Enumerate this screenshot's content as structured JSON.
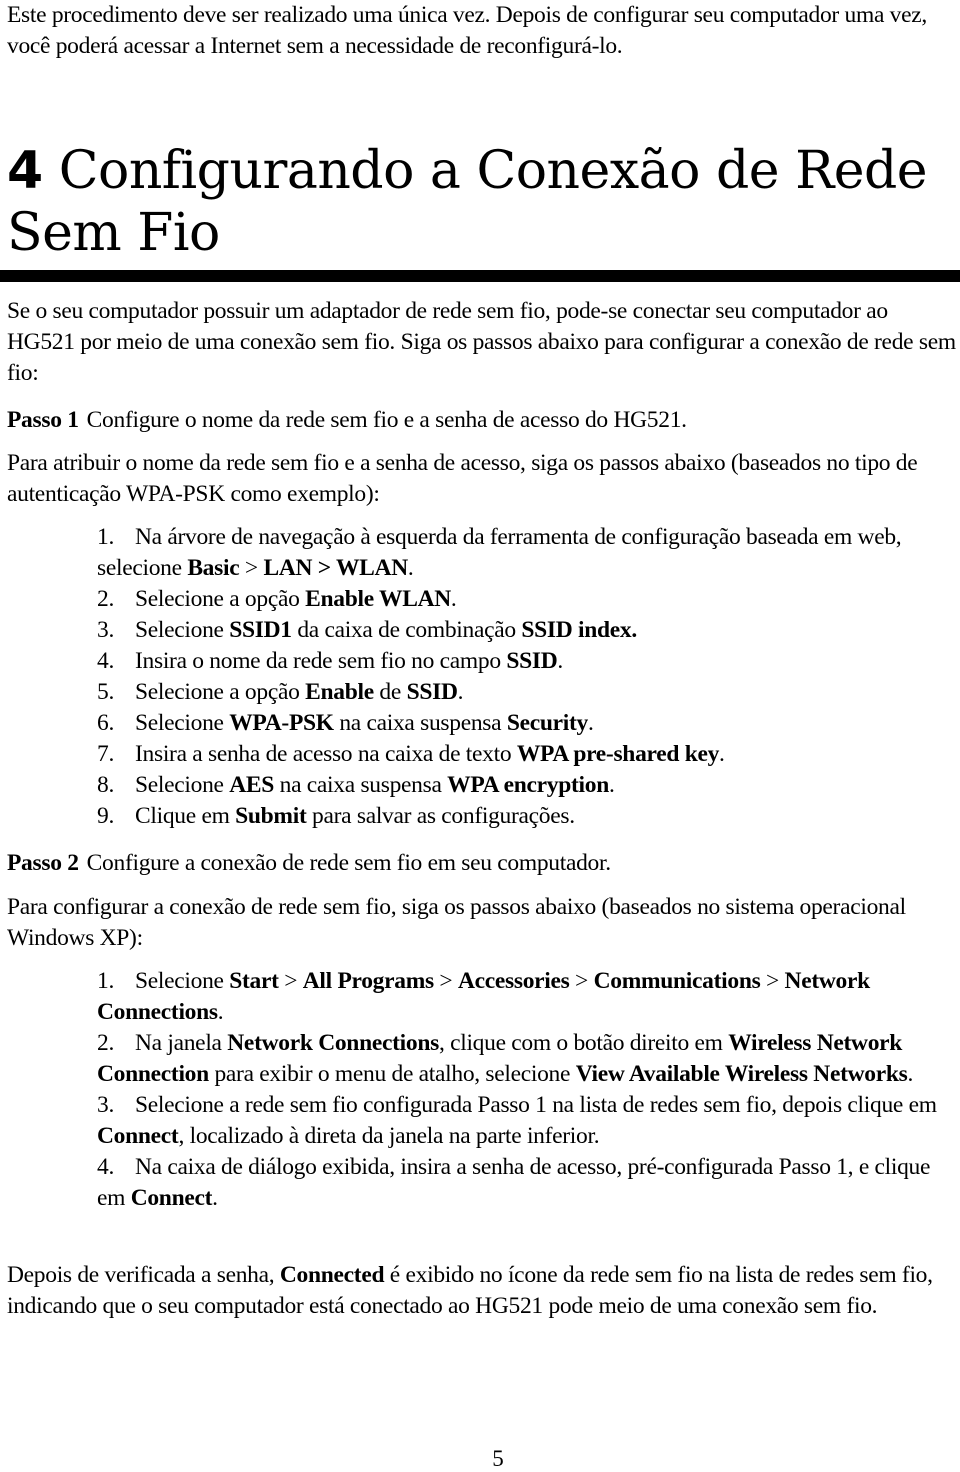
{
  "intro": {
    "text": "Este procedimento deve ser realizado uma única vez. Depois de configurar seu computador uma vez, você poderá acessar a Internet sem a necessidade de reconfigurá-lo."
  },
  "section": {
    "number": "4",
    "title": "Configurando a Conexão de Rede Sem Fio"
  },
  "section_intro": "Se o seu computador possuir um adaptador de rede sem fio, pode-se conectar seu computador ao HG521 por meio de uma conexão sem fio. Siga os passos abaixo para configurar a conexão de rede sem fio:",
  "step1": {
    "label": "Passo 1",
    "text": "Configure o nome da rede sem fio e a senha de acesso do HG521.",
    "intro": "Para atribuir o nome da rede sem fio e a senha de acesso, siga os passos abaixo (baseados no tipo de autenticação WPA-PSK como exemplo):",
    "items": [
      {
        "n": "1.",
        "parts": [
          [
            "Na árvore de navegação à esquerda da ferramenta de configuração baseada em web, selecione ",
            false
          ],
          [
            "Basic",
            true
          ],
          [
            " > ",
            false
          ],
          [
            "LAN > WLAN",
            true
          ],
          [
            ".",
            false
          ]
        ]
      },
      {
        "n": "2.",
        "parts": [
          [
            "Selecione a opção ",
            false
          ],
          [
            "Enable WLAN",
            true
          ],
          [
            ".",
            false
          ]
        ]
      },
      {
        "n": "3.",
        "parts": [
          [
            "Selecione ",
            false
          ],
          [
            "SSID1",
            true
          ],
          [
            " da caixa de combinação ",
            false
          ],
          [
            "SSID index.",
            true
          ]
        ]
      },
      {
        "n": "4.",
        "parts": [
          [
            "Insira o nome da rede sem fio no campo ",
            false
          ],
          [
            "SSID",
            true
          ],
          [
            ".",
            false
          ]
        ]
      },
      {
        "n": "5.",
        "parts": [
          [
            "Selecione a opção ",
            false
          ],
          [
            "Enable",
            true
          ],
          [
            " de ",
            false
          ],
          [
            "SSID",
            true
          ],
          [
            ".",
            false
          ]
        ]
      },
      {
        "n": "6.",
        "parts": [
          [
            "Selecione ",
            false
          ],
          [
            "WPA-PSK",
            true
          ],
          [
            " na caixa suspensa ",
            false
          ],
          [
            "Security",
            true
          ],
          [
            ".",
            false
          ]
        ]
      },
      {
        "n": "7.",
        "parts": [
          [
            "Insira a senha de acesso na caixa de texto ",
            false
          ],
          [
            "WPA pre-shared key",
            true
          ],
          [
            ".",
            false
          ]
        ]
      },
      {
        "n": "8.",
        "parts": [
          [
            "Selecione ",
            false
          ],
          [
            "AES",
            true
          ],
          [
            " na caixa suspensa ",
            false
          ],
          [
            "WPA encryption",
            true
          ],
          [
            ".",
            false
          ]
        ]
      },
      {
        "n": "9.",
        "parts": [
          [
            "Clique em ",
            false
          ],
          [
            "Submit",
            true
          ],
          [
            " para salvar as configurações.",
            false
          ]
        ]
      }
    ]
  },
  "step2": {
    "label": "Passo 2",
    "text": "Configure a conexão de rede sem fio em seu computador.",
    "intro": "Para configurar a conexão de rede sem fio, siga os passos abaixo (baseados no sistema operacional Windows XP):",
    "items": [
      {
        "n": "1.",
        "parts": [
          [
            "Selecione ",
            false
          ],
          [
            "Start",
            true
          ],
          [
            " > ",
            false
          ],
          [
            "All Programs",
            true
          ],
          [
            " > ",
            false
          ],
          [
            "Accessories",
            true
          ],
          [
            " > ",
            false
          ],
          [
            "Communications",
            true
          ],
          [
            " > ",
            false
          ],
          [
            "Network Connections",
            true
          ],
          [
            ".",
            false
          ]
        ]
      },
      {
        "n": "2.",
        "parts": [
          [
            "Na janela ",
            false
          ],
          [
            "Network Connections",
            true
          ],
          [
            ", clique com o botão direito em ",
            false
          ],
          [
            "Wireless Network Connection",
            true
          ],
          [
            " para exibir o menu de atalho, selecione ",
            false
          ],
          [
            "View Available Wireless Networks",
            true
          ],
          [
            ".",
            false
          ]
        ]
      },
      {
        "n": "3.",
        "parts": [
          [
            "Selecione a rede sem fio configurada Passo 1 na lista de redes sem fio, depois clique em ",
            false
          ],
          [
            "Connect",
            true
          ],
          [
            ", localizado à direta da janela na parte inferior.",
            false
          ]
        ]
      },
      {
        "n": "4.",
        "parts": [
          [
            "Na caixa de diálogo exibida, insira a senha de acesso, pré-configurada Passo 1, e clique em ",
            false
          ],
          [
            "Connect",
            true
          ],
          [
            ".",
            false
          ]
        ]
      }
    ]
  },
  "conclusion": {
    "parts": [
      [
        "Depois de verificada a senha, ",
        false
      ],
      [
        "Connected",
        true
      ],
      [
        " é exibido no ícone da rede sem fio na lista de redes sem fio, indicando que o seu computador está conectado ao HG521 pode meio de uma conexão sem fio.",
        false
      ]
    ]
  },
  "page_number": "5"
}
